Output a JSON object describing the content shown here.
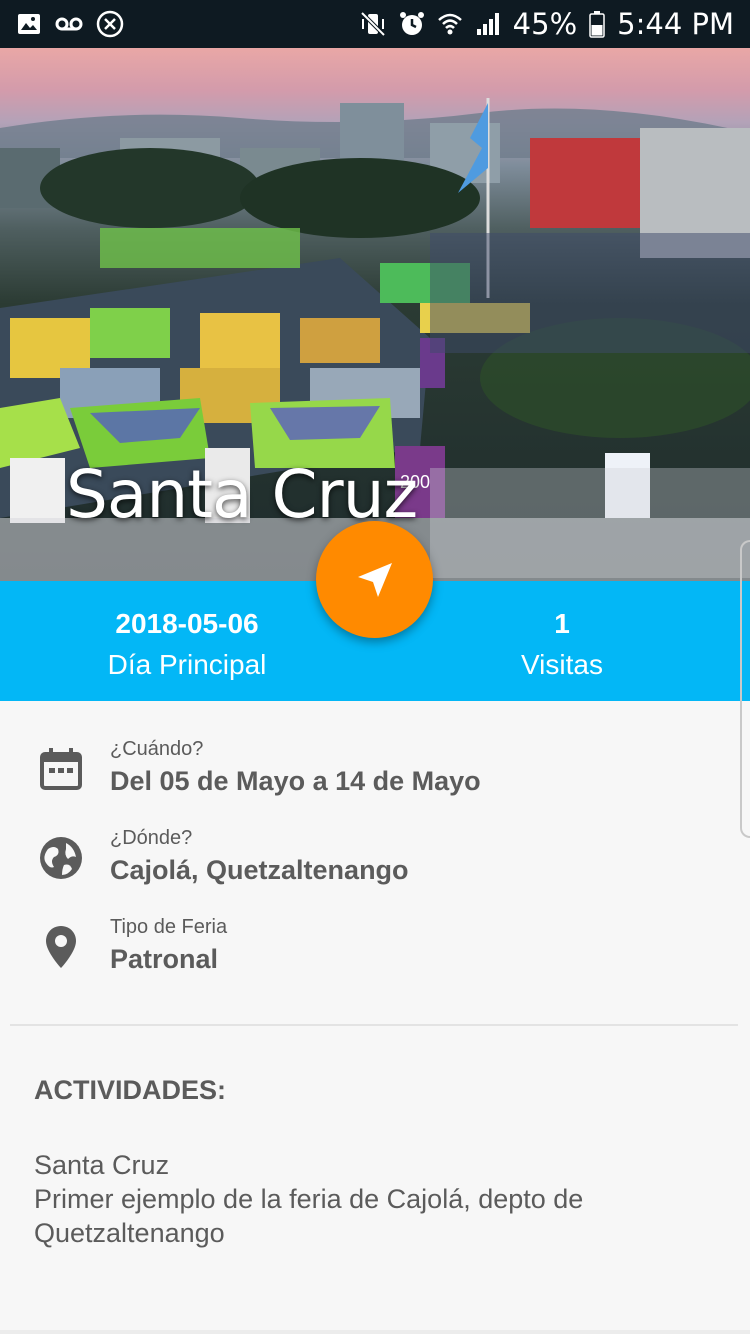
{
  "status_bar": {
    "battery": "45%",
    "time": "5:44 PM",
    "left_icons": [
      "image-icon",
      "voicemail-icon",
      "close-circle-icon"
    ],
    "right_icons": [
      "vibrate-mute-icon",
      "alarm-icon",
      "wifi-icon",
      "signal-icon",
      "battery-icon"
    ]
  },
  "hero": {
    "title": "Santa Cruz",
    "banner_text": "200"
  },
  "stats": {
    "date_value": "2018-05-06",
    "date_label": "Día Principal",
    "visits_value": "1",
    "visits_label": "Visitas"
  },
  "info": {
    "when_label": "¿Cuándo?",
    "when_value": "Del 05 de Mayo a 14 de Mayo",
    "where_label": "¿Dónde?",
    "where_value": "Cajolá, Quetzaltenango",
    "type_label": "Tipo de Feria",
    "type_value": "Patronal"
  },
  "activities": {
    "title": "ACTIVIDADES:",
    "line1": "Santa Cruz",
    "line2": "Primer ejemplo de la feria de Cajolá, depto de Quetzaltenango"
  },
  "colors": {
    "accent_blue": "#03b7f6",
    "fab_orange": "#ff8a00",
    "text_gray": "#5b5b5b",
    "status_bar": "#0e1a22"
  }
}
